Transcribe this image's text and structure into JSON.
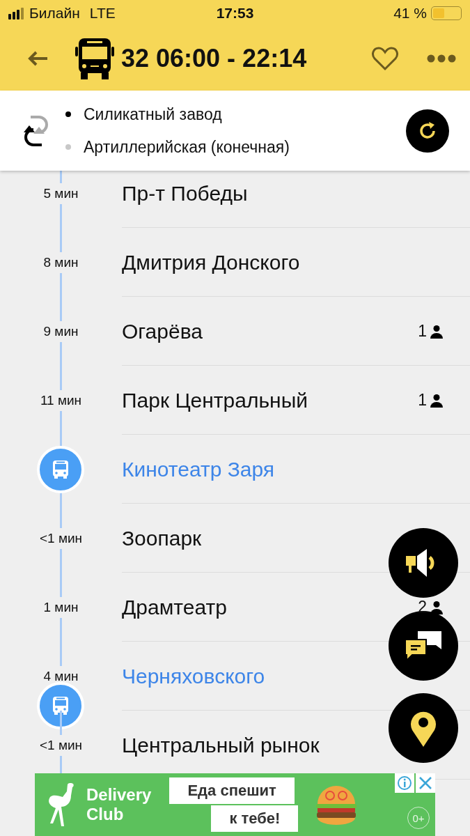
{
  "status_bar": {
    "carrier": "Билайн",
    "network": "LTE",
    "time": "17:53",
    "battery": "41 %"
  },
  "header": {
    "route": "32 06:00 - 22:14"
  },
  "direction": {
    "stops": [
      {
        "name": "Силикатный завод",
        "selected": true
      },
      {
        "name": "Артиллерийская (конечная)",
        "selected": false
      }
    ]
  },
  "stops": [
    {
      "kind": "stop",
      "time": "5 мин",
      "name": "Пр-т Победы"
    },
    {
      "kind": "stop",
      "time": "8 мин",
      "name": "Дмитрия Донского"
    },
    {
      "kind": "stop",
      "time": "9 мин",
      "name": "Огарёва",
      "passengers": "1"
    },
    {
      "kind": "stop",
      "time": "11 мин",
      "name": "Парк Центральный",
      "passengers": "1"
    },
    {
      "kind": "bus",
      "name": "Кинотеатр Заря"
    },
    {
      "kind": "stop",
      "time": "<1 мин",
      "name": "Зоопарк"
    },
    {
      "kind": "stop",
      "time": "1 мин",
      "name": "Драмтеатр",
      "passengers": "2"
    },
    {
      "kind": "bus",
      "time": "4 мин",
      "name": "Черняховского"
    },
    {
      "kind": "stop",
      "time": "<1 мин",
      "name": "Центральный рынок"
    }
  ],
  "ad": {
    "brand_line_1": "Delivery",
    "brand_line_2": "Club",
    "slogan_line_1": "Еда спешит",
    "slogan_line_2": "к тебе!",
    "age": "0+"
  }
}
